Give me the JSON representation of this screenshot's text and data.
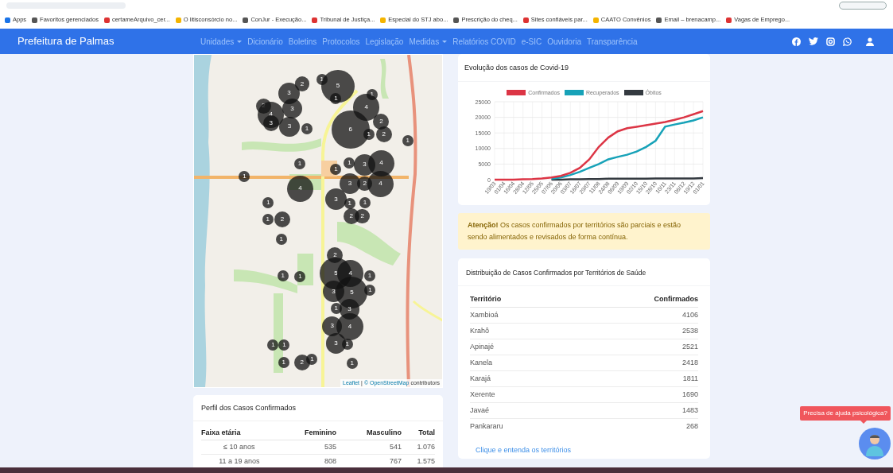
{
  "bookmarks": [
    "Apps",
    "Favoritos gerenciados",
    "certameArquivo_cer...",
    "O litisconsórcio no...",
    "ConJur - Execução...",
    "Tribunal de Justiça...",
    "Especial do STJ abo...",
    "Prescrição do cheq...",
    "Sites confiáveis par...",
    "CAATO Convênios",
    "Email – brenacamp...",
    "Vagas de Emprego..."
  ],
  "navbar": {
    "brand": "Prefeitura de Palmas",
    "items": [
      {
        "label": "Unidades",
        "dropdown": true
      },
      {
        "label": "Dicionário",
        "dropdown": false
      },
      {
        "label": "Boletins",
        "dropdown": false
      },
      {
        "label": "Protocolos",
        "dropdown": false
      },
      {
        "label": "Legislação",
        "dropdown": false
      },
      {
        "label": "Medidas",
        "dropdown": true
      },
      {
        "label": "Relatórios COVID",
        "dropdown": false
      },
      {
        "label": "e-SIC",
        "dropdown": false
      },
      {
        "label": "Ouvidoria",
        "dropdown": false
      },
      {
        "label": "Transparência",
        "dropdown": false
      }
    ]
  },
  "map": {
    "clusters": [
      {
        "count": "2"
      },
      {
        "count": "1"
      },
      {
        "count": "5"
      },
      {
        "count": "3"
      },
      {
        "count": "1"
      },
      {
        "count": "1"
      },
      {
        "count": "2"
      },
      {
        "count": "3"
      },
      {
        "count": "4"
      },
      {
        "count": "4"
      },
      {
        "count": "3"
      },
      {
        "count": "3"
      },
      {
        "count": "1"
      },
      {
        "count": "6"
      },
      {
        "count": "2"
      },
      {
        "count": "1"
      },
      {
        "count": "2"
      },
      {
        "count": "1"
      },
      {
        "count": "1"
      },
      {
        "count": "1"
      },
      {
        "count": "1"
      },
      {
        "count": "3"
      },
      {
        "count": "4"
      },
      {
        "count": "1"
      },
      {
        "count": "4"
      },
      {
        "count": "3"
      },
      {
        "count": "2"
      },
      {
        "count": "4"
      },
      {
        "count": "1"
      },
      {
        "count": "3"
      },
      {
        "count": "1"
      },
      {
        "count": "1"
      },
      {
        "count": "1"
      },
      {
        "count": "2"
      },
      {
        "count": "2"
      },
      {
        "count": "2"
      },
      {
        "count": "1"
      },
      {
        "count": "2"
      },
      {
        "count": "1"
      },
      {
        "count": "1"
      },
      {
        "count": "5"
      },
      {
        "count": "4"
      },
      {
        "count": "1"
      },
      {
        "count": "3"
      },
      {
        "count": "5"
      },
      {
        "count": "1"
      },
      {
        "count": "1"
      },
      {
        "count": "3"
      },
      {
        "count": "3"
      },
      {
        "count": "4"
      },
      {
        "count": "1"
      },
      {
        "count": "1"
      },
      {
        "count": "3"
      },
      {
        "count": "1"
      },
      {
        "count": "1"
      },
      {
        "count": "2"
      },
      {
        "count": "1"
      },
      {
        "count": "1"
      }
    ],
    "attribution_link": "Leaflet",
    "attribution_sep": "|",
    "attribution_osm": "© OpenStreetMap",
    "attribution_rest": "contributors"
  },
  "chart_card": {
    "title": "Evolução dos casos de Covid-19",
    "chart_data": {
      "type": "line",
      "categories": [
        "19/03",
        "01/04",
        "16/04",
        "28/04",
        "12/05",
        "25/05",
        "07/06",
        "20/06",
        "03/07",
        "16/07",
        "29/07",
        "11/08",
        "24/08",
        "06/09",
        "19/09",
        "02/10",
        "15/10",
        "28/10",
        "10/11",
        "23/11",
        "06/12",
        "19/12",
        "01/01"
      ],
      "ylim": [
        0,
        25000
      ],
      "yticks": [
        0,
        5000,
        10000,
        15000,
        20000,
        25000
      ],
      "grid": true,
      "legend": true,
      "series": [
        {
          "name": "Confirmados",
          "color": "#dc3545",
          "values": [
            0,
            0,
            0,
            100,
            200,
            400,
            700,
            1200,
            2200,
            3800,
            6500,
            10500,
            13500,
            15500,
            16500,
            17000,
            17500,
            18000,
            18500,
            19200,
            20000,
            21000,
            22000
          ]
        },
        {
          "name": "Recuperados",
          "color": "#17a2b8",
          "values": [
            null,
            null,
            null,
            null,
            null,
            null,
            300,
            700,
            1500,
            2500,
            3800,
            5000,
            6500,
            7300,
            8000,
            9000,
            10500,
            12500,
            17000,
            17700,
            18300,
            19000,
            20000
          ]
        },
        {
          "name": "Óbitos",
          "color": "#343a40",
          "values": [
            null,
            null,
            null,
            null,
            null,
            null,
            0,
            0,
            100,
            100,
            200,
            200,
            300,
            300,
            300,
            300,
            300,
            400,
            400,
            400,
            400,
            400,
            500
          ]
        }
      ]
    }
  },
  "alert": "**Atenção!** Os casos confirmados por territórios são parciais e estão sendo alimentados e revisados de forma contínua.",
  "territories": {
    "title": "Distribuição de Casos Confirmados por Territórios de Saúde",
    "columns": [
      "Território",
      "Confirmados"
    ],
    "rows": [
      [
        "Xambioá",
        "4106"
      ],
      [
        "Krahô",
        "2538"
      ],
      [
        "Apinajé",
        "2521"
      ],
      [
        "Kanela",
        "2418"
      ],
      [
        "Karajá",
        "1811"
      ],
      [
        "Xerente",
        "1690"
      ],
      [
        "Javaé",
        "1483"
      ],
      [
        "Pankararu",
        "268"
      ]
    ],
    "link": "Clique e entenda os territórios"
  },
  "profile": {
    "title": "Perfil dos Casos Confirmados",
    "columns": [
      "Faixa etária",
      "Feminino",
      "Masculino",
      "Total"
    ],
    "rows": [
      [
        "≤ 10 anos",
        "535",
        "541",
        "1.076"
      ],
      [
        "11 a 19 anos",
        "808",
        "767",
        "1.575"
      ]
    ]
  },
  "help": {
    "tooltip": "Precisa de ajuda psicológica?"
  }
}
